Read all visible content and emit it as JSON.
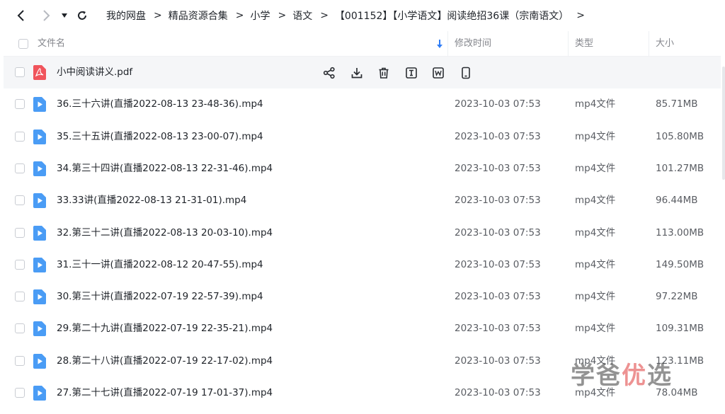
{
  "breadcrumb": [
    "我的网盘",
    "精品资源合集",
    "小学",
    "语文",
    "【001152】【小学语文】阅读绝招36课（宗南语文）"
  ],
  "table": {
    "headers": {
      "name": "文件名",
      "modified": "修改时间",
      "type": "类型",
      "size": "大小"
    },
    "hover_row_actions": [
      "share-icon",
      "download-icon",
      "delete-icon",
      "rename-icon",
      "word-convert-icon",
      "mobile-icon"
    ],
    "rows": [
      {
        "name": "小中阅读讲义.pdf",
        "modified": "",
        "type": "",
        "size": "",
        "kind": "pdf"
      },
      {
        "name": "36.三十六讲(直播2022-08-13 23-48-36).mp4",
        "modified": "2023-10-03 07:53",
        "type": "mp4文件",
        "size": "85.71MB",
        "kind": "video"
      },
      {
        "name": "35.三十五讲(直播2022-08-13 23-00-07).mp4",
        "modified": "2023-10-03 07:53",
        "type": "mp4文件",
        "size": "105.80MB",
        "kind": "video"
      },
      {
        "name": "34.第三十四讲(直播2022-08-13 22-31-46).mp4",
        "modified": "2023-10-03 07:53",
        "type": "mp4文件",
        "size": "101.27MB",
        "kind": "video"
      },
      {
        "name": "33.33讲(直播2022-08-13 21-31-01).mp4",
        "modified": "2023-10-03 07:53",
        "type": "mp4文件",
        "size": "96.44MB",
        "kind": "video"
      },
      {
        "name": "32.第三十二讲(直播2022-08-13 20-03-10).mp4",
        "modified": "2023-10-03 07:53",
        "type": "mp4文件",
        "size": "113.00MB",
        "kind": "video"
      },
      {
        "name": "31.三十一讲(直播2022-08-12 20-47-55).mp4",
        "modified": "2023-10-03 07:53",
        "type": "mp4文件",
        "size": "149.50MB",
        "kind": "video"
      },
      {
        "name": "30.第三十讲(直播2022-07-19 22-57-39).mp4",
        "modified": "2023-10-03 07:53",
        "type": "mp4文件",
        "size": "97.22MB",
        "kind": "video"
      },
      {
        "name": "29.第二十九讲(直播2022-07-19 22-35-21).mp4",
        "modified": "2023-10-03 07:53",
        "type": "mp4文件",
        "size": "109.31MB",
        "kind": "video"
      },
      {
        "name": "28.第二十八讲(直播2022-07-19 22-17-02).mp4",
        "modified": "2023-10-03 07:53",
        "type": "mp4文件",
        "size": "123.11MB",
        "kind": "video"
      },
      {
        "name": "27.第二十七讲(直播2022-07-19 17-01-37).mp4",
        "modified": "2023-10-03 07:53",
        "type": "mp4文件",
        "size": "78.04MB",
        "kind": "video"
      }
    ]
  },
  "watermark": {
    "part1": "学爸",
    "part2": "优",
    "part3": "选"
  },
  "colors": {
    "video_icon": "#4a9cf5",
    "pdf_icon": "#f0545c",
    "sort_arrow": "#2f7df6"
  }
}
